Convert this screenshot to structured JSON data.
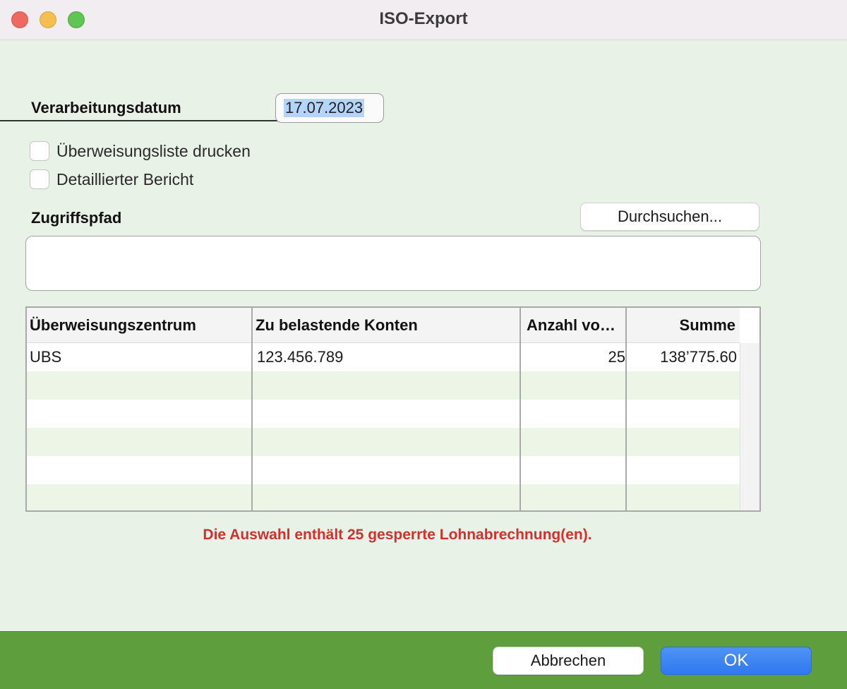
{
  "window": {
    "title": "ISO-Export"
  },
  "form": {
    "date_label": "Verarbeitungsdatum",
    "date_value": "17.07.2023",
    "checkboxes": [
      {
        "label": "Überweisungsliste drucken",
        "checked": false
      },
      {
        "label": "Detaillierter Bericht",
        "checked": false
      }
    ],
    "path_label": "Zugriffspfad",
    "browse_label": "Durchsuchen...",
    "path_value": ""
  },
  "table": {
    "headers": [
      "Überweisungszentrum",
      "Zu belastende Konten",
      "Anzahl vo…",
      "Summe"
    ],
    "rows": [
      [
        "UBS",
        "123.456.789",
        "25",
        "138’775.60"
      ]
    ]
  },
  "warning": "Die Auswahl enthält 25 gesperrte Lohnabrechnung(en).",
  "footer": {
    "cancel_label": "Abbrechen",
    "ok_label": "OK"
  },
  "colors": {
    "accent": "#2f78ee",
    "footer": "#5f9e3d",
    "warning": "#d0312d",
    "background": "#e9f2e6"
  }
}
